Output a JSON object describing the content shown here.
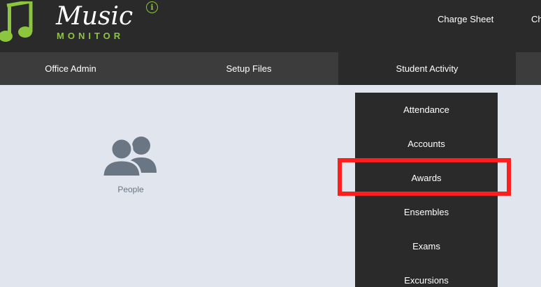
{
  "header": {
    "logo_title": "Music",
    "logo_subtitle": "MONITOR",
    "top_links": [
      "Charge Sheet",
      "Ch"
    ],
    "colors": {
      "logo_green": "#8cc63f",
      "bar_dark": "#2a2a2a"
    },
    "info_icon": "info-icon"
  },
  "nav": {
    "items": [
      "Office Admin",
      "Setup Files",
      "Student Activity"
    ],
    "active": "Student Activity"
  },
  "main": {
    "people_label": "People",
    "people_icon": "people-icon"
  },
  "dropdown": {
    "items": [
      "Attendance",
      "Accounts",
      "Awards",
      "Ensembles",
      "Exams",
      "Excursions"
    ],
    "highlighted": "Awards",
    "highlight_color": "#ff1e1e"
  }
}
